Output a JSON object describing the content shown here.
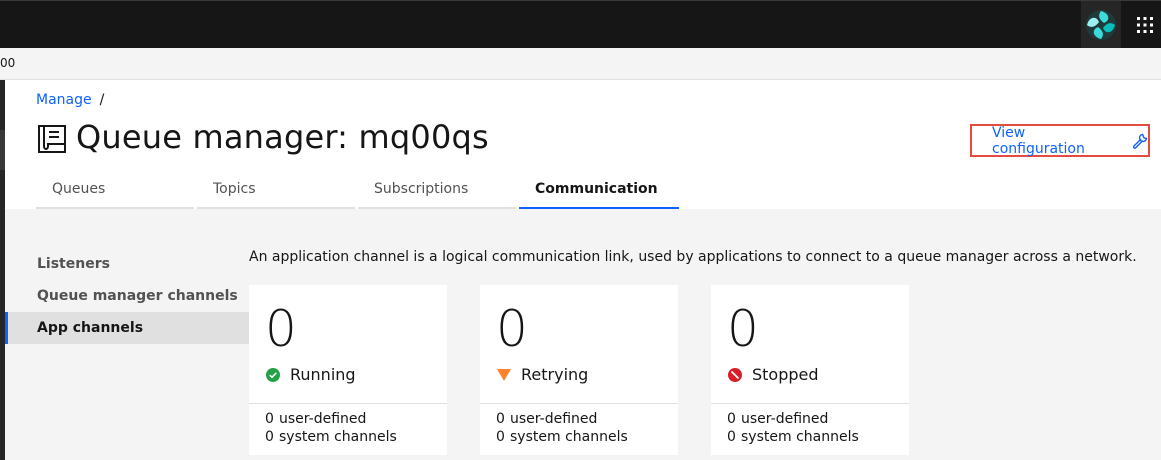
{
  "topbar": {
    "logo_icon": "ibm-mq-logo-icon",
    "apps_icon": "app-switcher-grid-icon"
  },
  "subbar": {
    "text": "00"
  },
  "breadcrumb": {
    "link": "Manage",
    "separator": "/"
  },
  "page": {
    "title": "Queue manager: mq00qs",
    "title_icon": "queue-manager-document-icon",
    "view_config_label": "View configuration",
    "view_config_icon": "wrench-icon"
  },
  "tabs": [
    {
      "label": "Queues",
      "active": false
    },
    {
      "label": "Topics",
      "active": false
    },
    {
      "label": "Subscriptions",
      "active": false
    },
    {
      "label": "Communication",
      "active": true
    }
  ],
  "sidenav": [
    {
      "label": "Listeners",
      "active": false
    },
    {
      "label": "Queue manager channels",
      "active": false
    },
    {
      "label": "App channels",
      "active": true
    }
  ],
  "description": "An application channel is a logical communication link, used by applications to connect to a queue manager across a network.",
  "cards": [
    {
      "count": "0",
      "status": "Running",
      "status_icon": "checkmark-filled-icon",
      "status_color": "#24a148",
      "user_defined_count": "0",
      "user_defined_label": "user-defined",
      "system_count": "0",
      "system_label": "system channels"
    },
    {
      "count": "0",
      "status": "Retrying",
      "status_icon": "warning-triangle-icon",
      "status_color": "#ff832b",
      "user_defined_count": "0",
      "user_defined_label": "user-defined",
      "system_count": "0",
      "system_label": "system channels"
    },
    {
      "count": "0",
      "status": "Stopped",
      "status_icon": "stopped-icon",
      "status_color": "#da1e28",
      "user_defined_count": "0",
      "user_defined_label": "user-defined",
      "system_count": "0",
      "system_label": "system channels"
    }
  ],
  "colors": {
    "accent": "#0f62fe",
    "highlight_border": "#e34c3e",
    "topbar": "#161616"
  }
}
